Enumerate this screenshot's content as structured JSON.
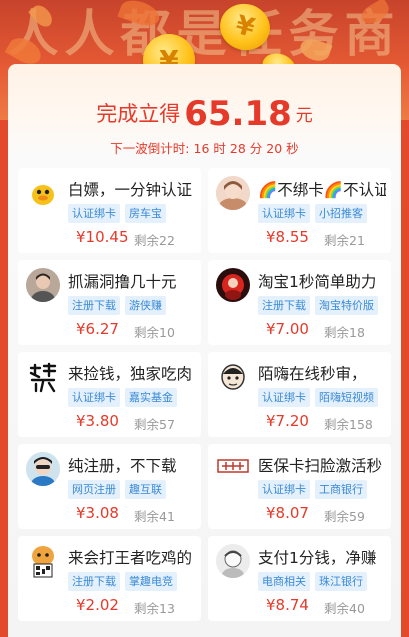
{
  "header": {
    "bg_title": "人人都是任务商",
    "reward_prefix": "完成立得",
    "reward_amount": "65.18",
    "reward_unit": "元",
    "countdown_label": "下一波倒计时:",
    "countdown_h": "16",
    "countdown_h_unit": "时",
    "countdown_m": "28",
    "countdown_m_unit": "分",
    "countdown_s": "20",
    "countdown_s_unit": "秒"
  },
  "tasks": [
    {
      "title": "白嫖，一分钟认证",
      "tags": [
        "认证绑卡",
        "房车宝"
      ],
      "price": "¥10.45",
      "remain": "剩余22",
      "avatar_icon": "duck-avatar"
    },
    {
      "title": "🌈不绑卡🌈不认证",
      "tags": [
        "认证绑卡",
        "小招推客"
      ],
      "price": "¥8.55",
      "remain": "剩余21",
      "avatar_icon": "girl-avatar"
    },
    {
      "title": "抓漏洞撸几十元",
      "tags": [
        "注册下载",
        "游侠赚"
      ],
      "price": "¥6.27",
      "remain": "剩余10",
      "avatar_icon": "person-avatar"
    },
    {
      "title": "淘宝1秒简单助力",
      "tags": [
        "注册下载",
        "淘宝特价版"
      ],
      "price": "¥7.00",
      "remain": "剩余18",
      "avatar_icon": "red-avatar"
    },
    {
      "title": "来捡钱，独家吃肉",
      "tags": [
        "认证绑卡",
        "嘉实基金"
      ],
      "price": "¥3.80",
      "remain": "剩余57",
      "avatar_icon": "calligraphy-avatar"
    },
    {
      "title": "陌嗨在线秒审，",
      "tags": [
        "认证绑卡",
        "陌嗨短视频"
      ],
      "price": "¥7.20",
      "remain": "剩余158",
      "avatar_icon": "cartoon-avatar"
    },
    {
      "title": "纯注册，不下载",
      "tags": [
        "网页注册",
        "趣互联"
      ],
      "price": "¥3.08",
      "remain": "剩余41",
      "avatar_icon": "blue-person-avatar"
    },
    {
      "title": "医保卡扫脸激活秒",
      "tags": [
        "认证绑卡",
        "工商银行"
      ],
      "price": "¥8.07",
      "remain": "剩余59",
      "avatar_icon": "logo-avatar"
    },
    {
      "title": "来会打王者吃鸡的",
      "tags": [
        "注册下载",
        "掌趣电竞"
      ],
      "price": "¥2.02",
      "remain": "剩余13",
      "avatar_icon": "qr-avatar"
    },
    {
      "title": "支付1分钱，净赚",
      "tags": [
        "电商相关",
        "珠江银行"
      ],
      "price": "¥8.74",
      "remain": "剩余40",
      "avatar_icon": "sketch-avatar"
    }
  ],
  "colors": {
    "accent_red": "#e53a2a",
    "tag_bg": "#e4f0fb",
    "tag_text": "#3a8ad7",
    "coin_gold": "#ffc21a"
  }
}
